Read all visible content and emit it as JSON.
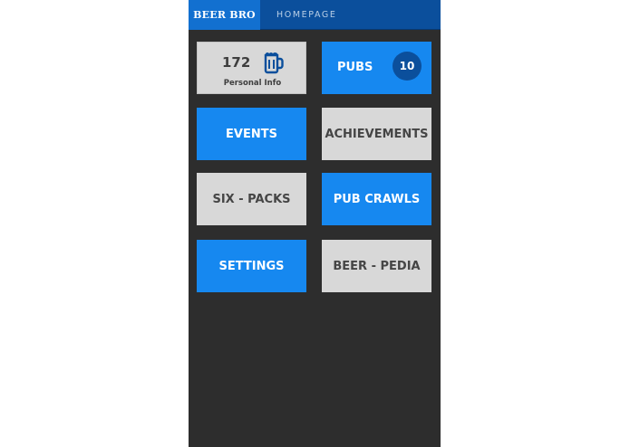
{
  "header": {
    "brand": "BEER BRO",
    "page": "HOMEPAGE"
  },
  "tiles": {
    "personal": {
      "count": "172",
      "label": "Personal Info",
      "icon": "beer-mug-icon"
    },
    "pubs": {
      "label": "PUBS",
      "badge": "10"
    },
    "events": {
      "label": "EVENTS"
    },
    "achievements": {
      "label": "ACHIEVEMENTS"
    },
    "six_packs": {
      "label": "SIX - PACKS"
    },
    "pub_crawls": {
      "label": "PUB CRAWLS"
    },
    "settings": {
      "label": "SETTINGS"
    },
    "beer_pedia": {
      "label": "BEER - PEDIA"
    }
  },
  "colors": {
    "background": "#2d2d2d",
    "topbar": "#0b4f9c",
    "brand": "#1270d0",
    "tile_blue": "#1688f0",
    "tile_gray": "#d8d8d8",
    "badge": "#0b4f9c"
  }
}
